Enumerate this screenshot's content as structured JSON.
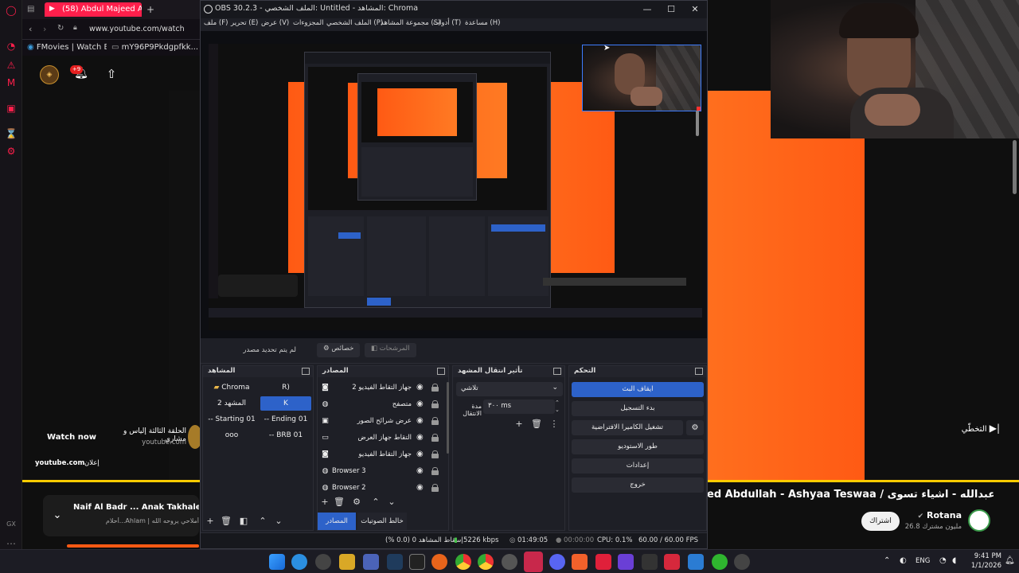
{
  "browser": {
    "tab_title": "(58) Abdul Majeed Abd",
    "tab_add": "+",
    "address": "www.youtube.com/watch",
    "bookmarks": [
      "FMovies | Watch B...",
      "mY96P9Pkdgpfkk..."
    ],
    "notification_count": "+9"
  },
  "youtube": {
    "watch_now": "Watch now",
    "ad_line1": "الحلقة الثالثة إلياس و مشاري",
    "ad_line2": "youtube.com",
    "ad_domain": "youtube.com",
    "ad_badge": "إعلان",
    "skip_label": "التخطّي",
    "video_title": "ed Abdullah - Ashyaa Teswaa / عبدالمجيد عبدالله - اشياء تسوى",
    "channel_name": "Rotana",
    "subscriber_count": "26.8 مليون مشترك",
    "subscribe_label": "اشتراك",
    "up_next_title": "Naif Al Badr ... Anak Takhalet | خليتك",
    "up_next_sub": "أحلام...Ahlam | أملاحي يروحه الله",
    "gx_label": "GX"
  },
  "obs": {
    "title": "OBS 30.2.3 - الملف الشخصي: Untitled - المشاهد: Chroma",
    "window_minimize": "—",
    "window_maximize": "☐",
    "window_close": "✕",
    "menu": [
      "ملف (F)",
      "تحرير (E)",
      "عرض (V)",
      "المجزوءات",
      "الملف الشخصي (P)",
      "مجموعة المشاهد (S)",
      "أدوات (T)",
      "مساعدة (H)"
    ],
    "no_source": "لم يتم تحديد مصدر",
    "properties_label": "خصائص",
    "filters_label": "المرشحات",
    "docks": {
      "scenes": "المشاهد",
      "sources": "المصادر",
      "transitions": "تأثير انتقال المشهد",
      "controls": "التحكم"
    },
    "scenes": [
      [
        "Chroma",
        "R)"
      ],
      [
        "المشهد 2",
        "K"
      ],
      [
        "-- Starting 01",
        "-- Ending 01"
      ],
      [
        "ooo",
        "-- BRB 01"
      ]
    ],
    "sources": [
      {
        "icon": "camera-icon",
        "label": "جهاز التقاط الفيديو 2"
      },
      {
        "icon": "globe-icon",
        "label": "متصفح"
      },
      {
        "icon": "slideshow-icon",
        "label": "عرض شرائح الصور"
      },
      {
        "icon": "monitor-icon",
        "label": "التقاط جهاز العرض"
      },
      {
        "icon": "camera-icon",
        "label": "جهاز التقاط الفيديو"
      },
      {
        "icon": "globe-icon",
        "label": "Browser 3"
      },
      {
        "icon": "globe-icon",
        "label": "Browser 2"
      }
    ],
    "source_tabs": [
      "المصادر",
      "خالط الصوتيات"
    ],
    "transition": {
      "type": "تلاشي",
      "duration_label": "مدة الانتقال",
      "duration_value": "٣٠٠ ms"
    },
    "controls": [
      "ايقاف البث",
      "بدء التسجيل",
      "تشغيل الكاميرا الافتراضية",
      "طور الاستوديو",
      "إعدادات",
      "خروج"
    ],
    "status": {
      "dropped": "إسقاط المشاهد 0 (0.0 %)",
      "bitrate": "5226 kbps",
      "stream_time": "01:49:05",
      "rec_time": "00:00:00",
      "cpu": "CPU: 0.1%",
      "fps": "60.00 / 60.00 FPS"
    }
  },
  "taskbar": {
    "lang": "ENG",
    "time": "9:41 PM",
    "date": "1/1/2026"
  },
  "colors": {
    "accent": "#2d62c9",
    "gx_red": "#ff1f4b",
    "video_orange": "#ff6e1f",
    "obs_bg": "#1e1f26"
  }
}
